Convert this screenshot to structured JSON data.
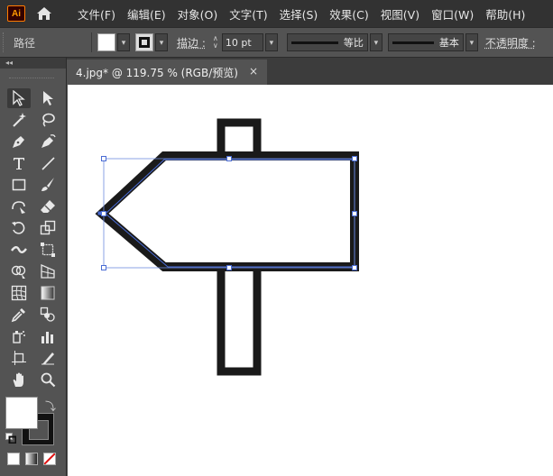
{
  "app": {
    "logo_text": "Ai"
  },
  "menu": [
    "文件(F)",
    "编辑(E)",
    "对象(O)",
    "文字(T)",
    "选择(S)",
    "效果(C)",
    "视图(V)",
    "窗口(W)",
    "帮助(H)"
  ],
  "control_bar": {
    "selection_label": "路径",
    "stroke_label": "描边 :",
    "stroke_weight": "10 pt",
    "profile_label": "等比",
    "brush_label": "基本",
    "opacity_label": "不透明度 :"
  },
  "document_tab": {
    "title": "4.jpg* @ 119.75 % (RGB/预览)",
    "close_symbol": "×"
  },
  "toolbar": {
    "tools": [
      "selection-tool",
      "direct-selection-tool",
      "magic-wand-tool",
      "lasso-tool",
      "pen-tool",
      "curvature-tool",
      "type-tool",
      "line-segment-tool",
      "rectangle-tool",
      "paintbrush-tool",
      "shaper-tool",
      "eraser-tool",
      "rotate-tool",
      "scale-tool",
      "width-tool",
      "free-transform-tool",
      "shape-builder-tool",
      "perspective-grid-tool",
      "mesh-tool",
      "gradient-tool",
      "eyedropper-tool",
      "blend-tool",
      "symbol-sprayer-tool",
      "column-graph-tool",
      "artboard-tool",
      "slice-tool",
      "hand-tool",
      "zoom-tool"
    ],
    "active_tool": "selection-tool"
  },
  "colors": {
    "fill": "#ffffff",
    "stroke": "#111111",
    "selection": "#4a6cd4"
  }
}
